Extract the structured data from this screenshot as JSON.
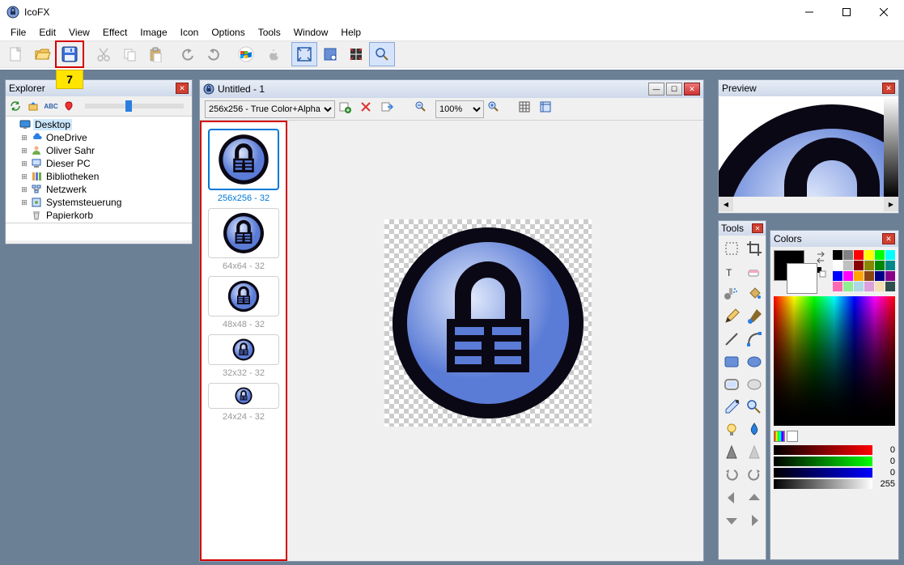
{
  "app": {
    "title": "IcoFX"
  },
  "menu": [
    "File",
    "Edit",
    "View",
    "Effect",
    "Image",
    "Icon",
    "Options",
    "Tools",
    "Window",
    "Help"
  ],
  "step_badge": "7",
  "explorer": {
    "title": "Explorer",
    "items": [
      {
        "label": "Desktop",
        "indent": 0,
        "expander": "",
        "icon": "desktop",
        "selected": true
      },
      {
        "label": "OneDrive",
        "indent": 1,
        "expander": "⊞",
        "icon": "cloud"
      },
      {
        "label": "Oliver Sahr",
        "indent": 1,
        "expander": "⊞",
        "icon": "user"
      },
      {
        "label": "Dieser PC",
        "indent": 1,
        "expander": "⊞",
        "icon": "pc"
      },
      {
        "label": "Bibliotheken",
        "indent": 1,
        "expander": "⊞",
        "icon": "lib"
      },
      {
        "label": "Netzwerk",
        "indent": 1,
        "expander": "⊞",
        "icon": "net"
      },
      {
        "label": "Systemsteuerung",
        "indent": 1,
        "expander": "⊞",
        "icon": "cpl"
      },
      {
        "label": "Papierkorb",
        "indent": 1,
        "expander": "",
        "icon": "bin"
      }
    ]
  },
  "doc": {
    "title": "Untitled - 1",
    "format": "256x256 - True Color+Alpha",
    "zoom": "100%",
    "thumbs": [
      {
        "label": "256x256 - 32",
        "size": 64,
        "selected": true
      },
      {
        "label": "64x64 - 32",
        "size": 52
      },
      {
        "label": "48x48 - 32",
        "size": 40
      },
      {
        "label": "32x32 - 32",
        "size": 28
      },
      {
        "label": "24x24 - 32",
        "size": 22
      }
    ]
  },
  "preview": {
    "title": "Preview"
  },
  "tools": {
    "title": "Tools"
  },
  "colors": {
    "title": "Colors",
    "swatches": [
      "#000",
      "#808080",
      "#f00",
      "#ff0",
      "#0f0",
      "#0ff",
      "#fff",
      "#c0c0c0",
      "#800",
      "#880",
      "#080",
      "#088",
      "#00f",
      "#f0f",
      "#ffa500",
      "#8b4513",
      "#008",
      "#808",
      "#ff69b4",
      "#90ee90",
      "#add8e6",
      "#dda0dd",
      "#f5deb3",
      "#2f4f4f"
    ],
    "r": 0,
    "g": 0,
    "b": 0,
    "a": 255
  }
}
